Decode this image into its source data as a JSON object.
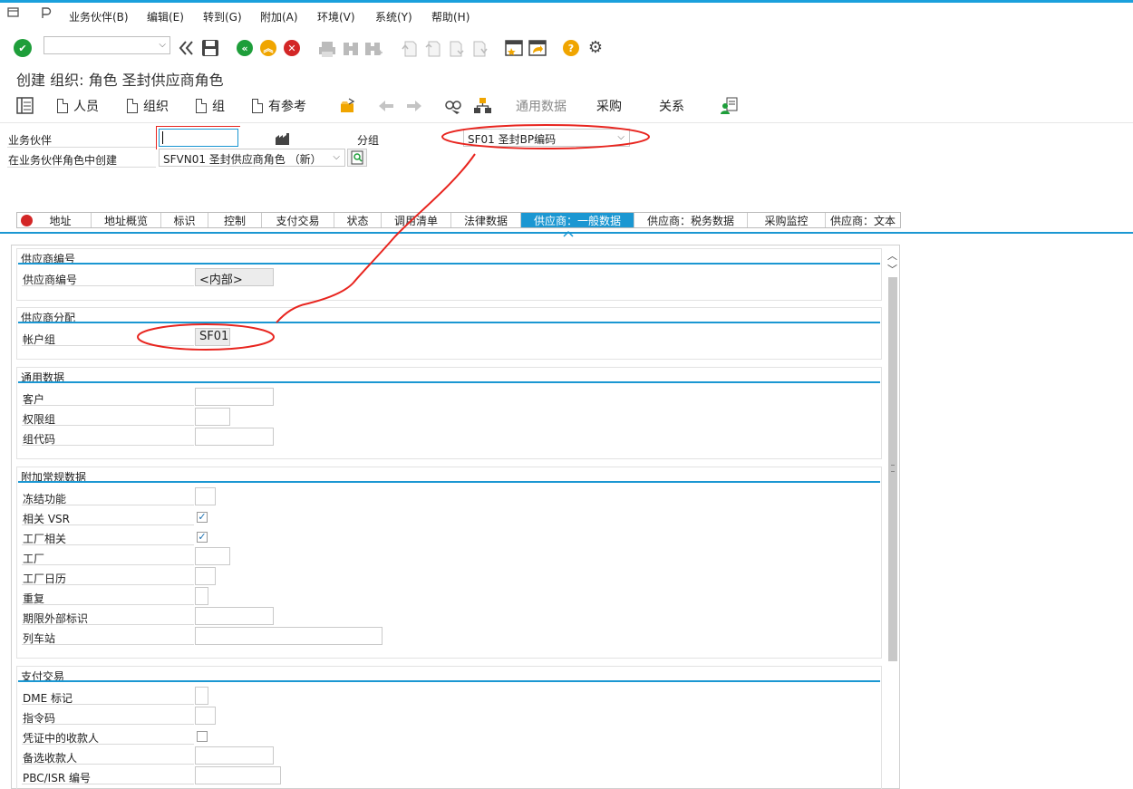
{
  "menu": {
    "items": [
      "业务伙伴(B)",
      "编辑(E)",
      "转到(G)",
      "附加(A)",
      "环境(V)",
      "系统(Y)",
      "帮助(H)"
    ]
  },
  "toolbar": {
    "command_value": "",
    "icons": [
      "check-icon",
      "back-double-icon",
      "save-icon",
      "back-icon",
      "exit-icon",
      "cancel-icon",
      "print-icon",
      "find-icon",
      "find-next-icon",
      "first-page-icon",
      "prev-page-icon",
      "next-page-icon",
      "last-page-icon",
      "new-session-icon",
      "shortcut-icon",
      "help-icon",
      "settings-icon"
    ]
  },
  "page": {
    "title": "创建 组织: 角色 圣封供应商角色"
  },
  "app_toolbar": {
    "person_label": "人员",
    "org_label": "组织",
    "group_label": "组",
    "with_ref_label": "有参考",
    "general_data_label": "通用数据",
    "purchasing_label": "采购",
    "relations_label": "关系"
  },
  "header": {
    "bp_label": "业务伙伴",
    "bp_value": "",
    "grouping_label": "分组",
    "grouping_value": "SF01 圣封BP编码",
    "role_label": "在业务伙伴角色中创建",
    "role_value": "SFVN01 圣封供应商角色 （新）"
  },
  "tabs": [
    {
      "label": "地址"
    },
    {
      "label": "地址概览"
    },
    {
      "label": "标识"
    },
    {
      "label": "控制"
    },
    {
      "label": "支付交易"
    },
    {
      "label": "状态"
    },
    {
      "label": "调用清单"
    },
    {
      "label": "法律数据"
    },
    {
      "label": "供应商：一般数据"
    },
    {
      "label": "供应商：税务数据"
    },
    {
      "label": "采购监控"
    },
    {
      "label": "供应商：文本"
    }
  ],
  "sections": {
    "vendor_number": {
      "title": "供应商编号",
      "field_label": "供应商编号",
      "field_value": "<内部>"
    },
    "vendor_assign": {
      "title": "供应商分配",
      "account_group_label": "帐户组",
      "account_group_value": "SF01"
    },
    "general": {
      "title": "通用数据",
      "customer_label": "客户",
      "auth_group_label": "权限组",
      "group_code_label": "组代码"
    },
    "additional": {
      "title": "附加常规数据",
      "freeze_label": "冻结功能",
      "vsr_label": "相关 VSR",
      "vsr_checked": true,
      "plant_rel_label": "工厂相关",
      "plant_rel_checked": true,
      "plant_label": "工厂",
      "plant_calendar_label": "工厂日历",
      "repeat_label": "重复",
      "external_id_label": "期限外部标识",
      "train_station_label": "列车站"
    },
    "payment": {
      "title": "支付交易",
      "dme_label": "DME 标记",
      "instruction_label": "指令码",
      "alt_payee_doc_label": "凭证中的收款人",
      "alt_payee_doc_checked": false,
      "alt_payee_label": "备选收款人",
      "pbc_label": "PBC/ISR 编号"
    }
  },
  "colors": {
    "accent": "#1b97d2",
    "annotation": "#e8251f",
    "ok_green": "#1e9e3a",
    "cancel_red": "#d32626",
    "help_orange": "#f0a500"
  }
}
